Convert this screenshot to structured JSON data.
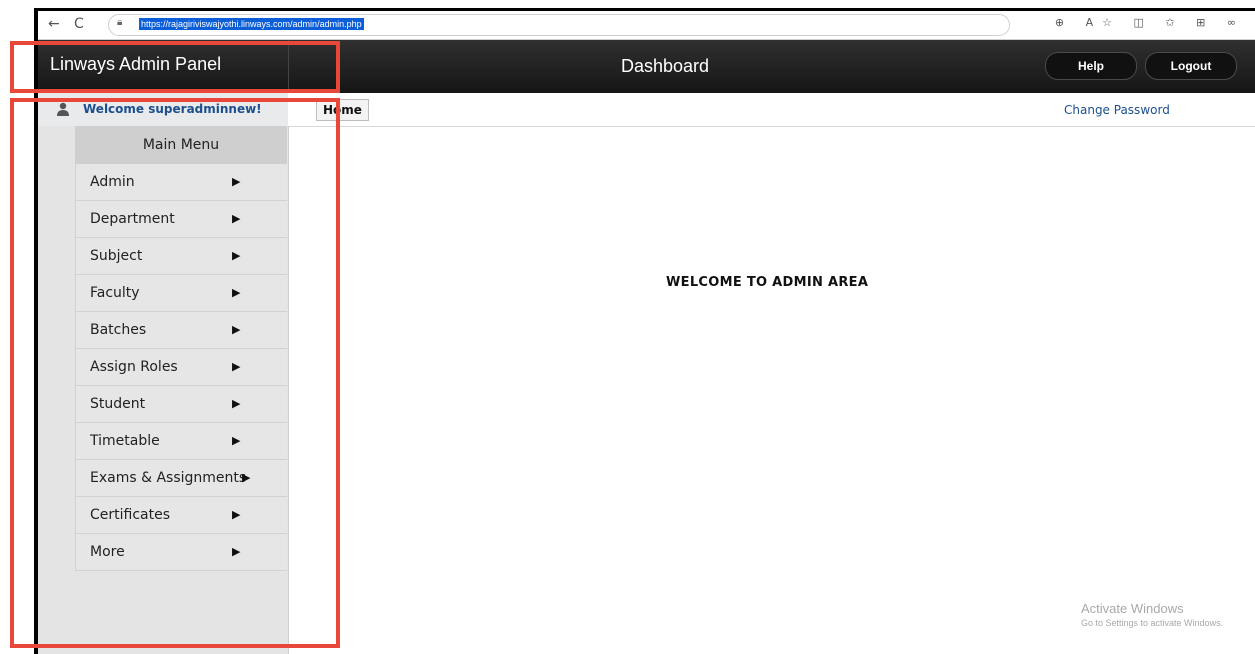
{
  "browser": {
    "url": "https://rajagiriviswajyothi.linways.com/admin/admin.php",
    "back_icon": "←",
    "refresh_icon": "C",
    "right_icons": "⊕ A☆ ◫ ✩ ⊞ ∞"
  },
  "header": {
    "brand": "Linways Admin Panel",
    "title": "Dashboard",
    "help_label": "Help",
    "logout_label": "Logout"
  },
  "subbar": {
    "welcome": "Welcome superadminnew!",
    "home_label": "Home",
    "change_password": "Change Password"
  },
  "sidebar": {
    "menu_title": "Main Menu",
    "items": [
      {
        "label": "Admin"
      },
      {
        "label": "Department"
      },
      {
        "label": "Subject"
      },
      {
        "label": "Faculty"
      },
      {
        "label": "Batches"
      },
      {
        "label": "Assign Roles"
      },
      {
        "label": "Student"
      },
      {
        "label": "Timetable"
      },
      {
        "label": "Exams & Assignments"
      },
      {
        "label": "Certificates"
      },
      {
        "label": "More"
      }
    ]
  },
  "main": {
    "welcome_message": "WELCOME TO ADMIN AREA"
  },
  "watermark": {
    "line1": "Activate Windows",
    "line2": "Go to Settings to activate Windows."
  },
  "colors": {
    "annotation": "#e8473a",
    "link": "#1b4f8e",
    "header_bg": "#1f1f1f"
  }
}
